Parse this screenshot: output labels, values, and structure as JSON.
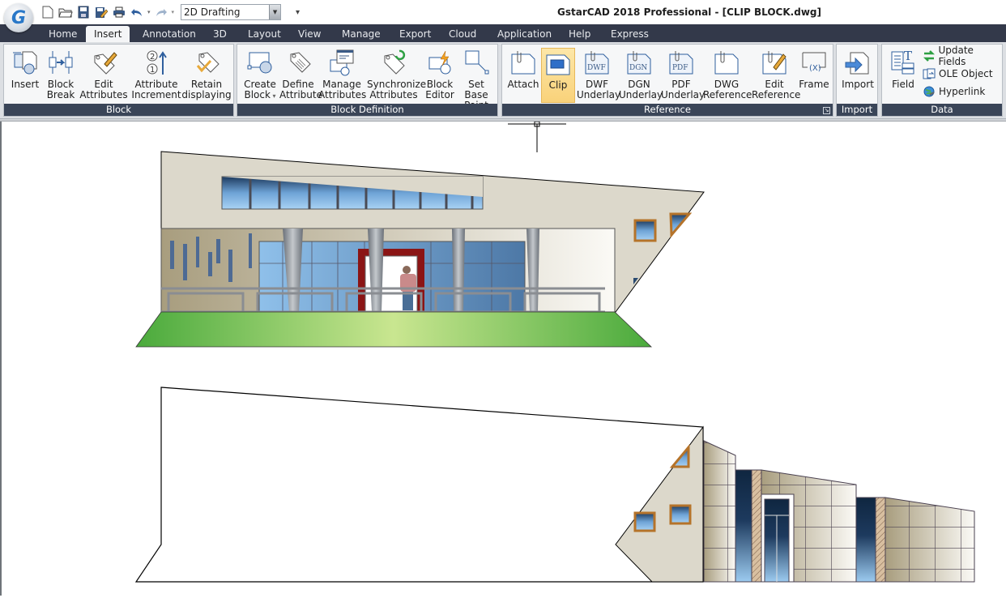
{
  "app": {
    "title": "GstarCAD 2018 Professional - [CLIP BLOCK.dwg]",
    "logo_letter": "G",
    "workspace": "2D Drafting"
  },
  "quick_access": [
    "new-icon",
    "open-icon",
    "save-icon",
    "save-as-icon",
    "print-icon",
    "undo-icon",
    "redo-icon"
  ],
  "tabs": [
    {
      "label": "Home",
      "active": false
    },
    {
      "label": "Insert",
      "active": true
    },
    {
      "label": "Annotation",
      "active": false
    },
    {
      "label": "3D",
      "active": false
    },
    {
      "label": "Layout",
      "active": false
    },
    {
      "label": "View",
      "active": false
    },
    {
      "label": "Manage",
      "active": false
    },
    {
      "label": "Export",
      "active": false
    },
    {
      "label": "Cloud",
      "active": false
    },
    {
      "label": "Application",
      "active": false
    },
    {
      "label": "Help",
      "active": false
    },
    {
      "label": "Express",
      "active": false
    }
  ],
  "ribbon": {
    "block": {
      "title": "Block",
      "buttons": [
        {
          "l1": "Insert",
          "l2": ""
        },
        {
          "l1": "Block",
          "l2": "Break"
        },
        {
          "l1": "Edit",
          "l2": "Attributes"
        },
        {
          "l1": "Attribute",
          "l2": "Increment"
        },
        {
          "l1": "Retain",
          "l2": "displaying"
        }
      ]
    },
    "block_definition": {
      "title": "Block Definition",
      "buttons": [
        {
          "l1": "Create",
          "l2": "Block"
        },
        {
          "l1": "Define",
          "l2": "Attribute"
        },
        {
          "l1": "Manage",
          "l2": "Attributes"
        },
        {
          "l1": "Synchronize",
          "l2": "Attributes"
        },
        {
          "l1": "Block",
          "l2": "Editor"
        },
        {
          "l1": "Set Base",
          "l2": "Point"
        }
      ]
    },
    "reference": {
      "title": "Reference",
      "buttons": [
        {
          "l1": "Attach",
          "l2": ""
        },
        {
          "l1": "Clip",
          "l2": "",
          "active": true
        },
        {
          "l1": "DWF",
          "l2": "Underlay",
          "tag": "DWF"
        },
        {
          "l1": "DGN",
          "l2": "Underlay",
          "tag": "DGN"
        },
        {
          "l1": "PDF",
          "l2": "Underlay",
          "tag": "PDF"
        },
        {
          "l1": "DWG",
          "l2": "Reference"
        },
        {
          "l1": "Edit",
          "l2": "Reference"
        },
        {
          "l1": "Frame",
          "l2": ""
        }
      ]
    },
    "import": {
      "title": "Import",
      "button": "Import"
    },
    "data": {
      "title": "Data",
      "field": "Field",
      "small": [
        "Update Fields",
        "OLE Object",
        "Hyperlink"
      ]
    }
  }
}
